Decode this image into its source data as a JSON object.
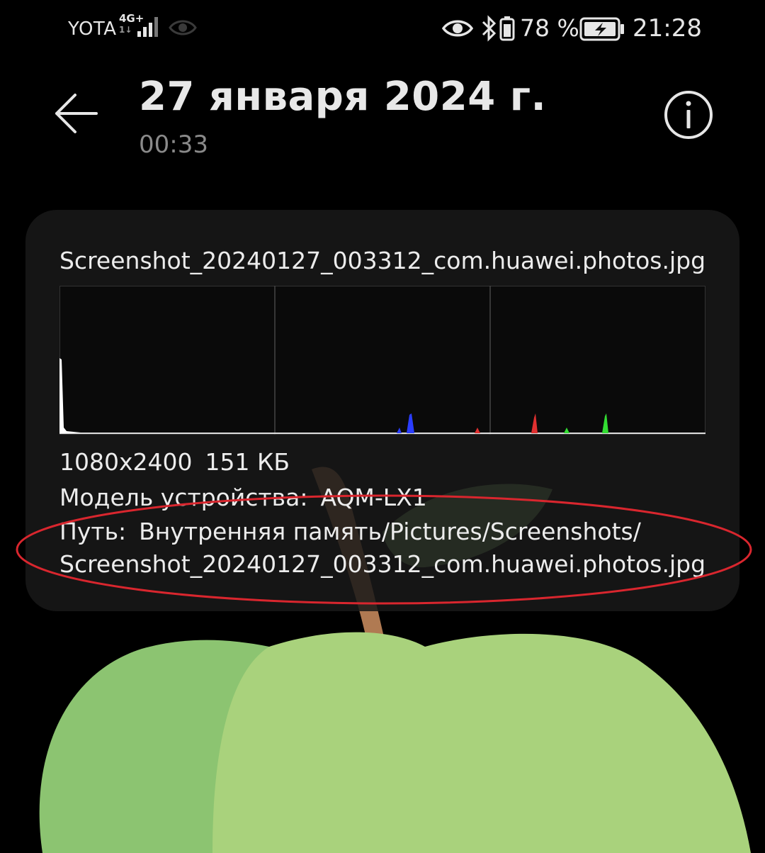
{
  "status_bar": {
    "carrier": "YOTA",
    "network_type": "4G+",
    "network_sub": "1↓",
    "battery_percent": "78 %",
    "time": "21:28",
    "icons": [
      "signal-icon",
      "eye-off-icon",
      "eye-icon",
      "bluetooth-icon",
      "battery-icon",
      "charging-icon"
    ]
  },
  "header": {
    "title": "27 января 2024 г.",
    "subtitle": "00:33",
    "back_icon": "back-arrow-icon",
    "info_icon": "info-icon"
  },
  "details": {
    "file_name": "Screenshot_20240127_003312_com.huawei.photos.jpg",
    "resolution": "1080x2400",
    "file_size": "151 КБ",
    "device_model_label": "Модель устройства:",
    "device_model_value": "AQM-LX1",
    "path_label": "Путь:",
    "path_line1": "Внутренняя память/Pictures/Screenshots/",
    "path_line2": "Screenshot_20240127_003312_com.huawei.photos.jpg"
  },
  "colors": {
    "background": "#000000",
    "card": "#181818",
    "annotation": "#d9262e",
    "apple_light": "#a9d27c",
    "apple_dark": "#8cc471",
    "stem": "#b07a52",
    "leaf": "#6f9a5a"
  }
}
